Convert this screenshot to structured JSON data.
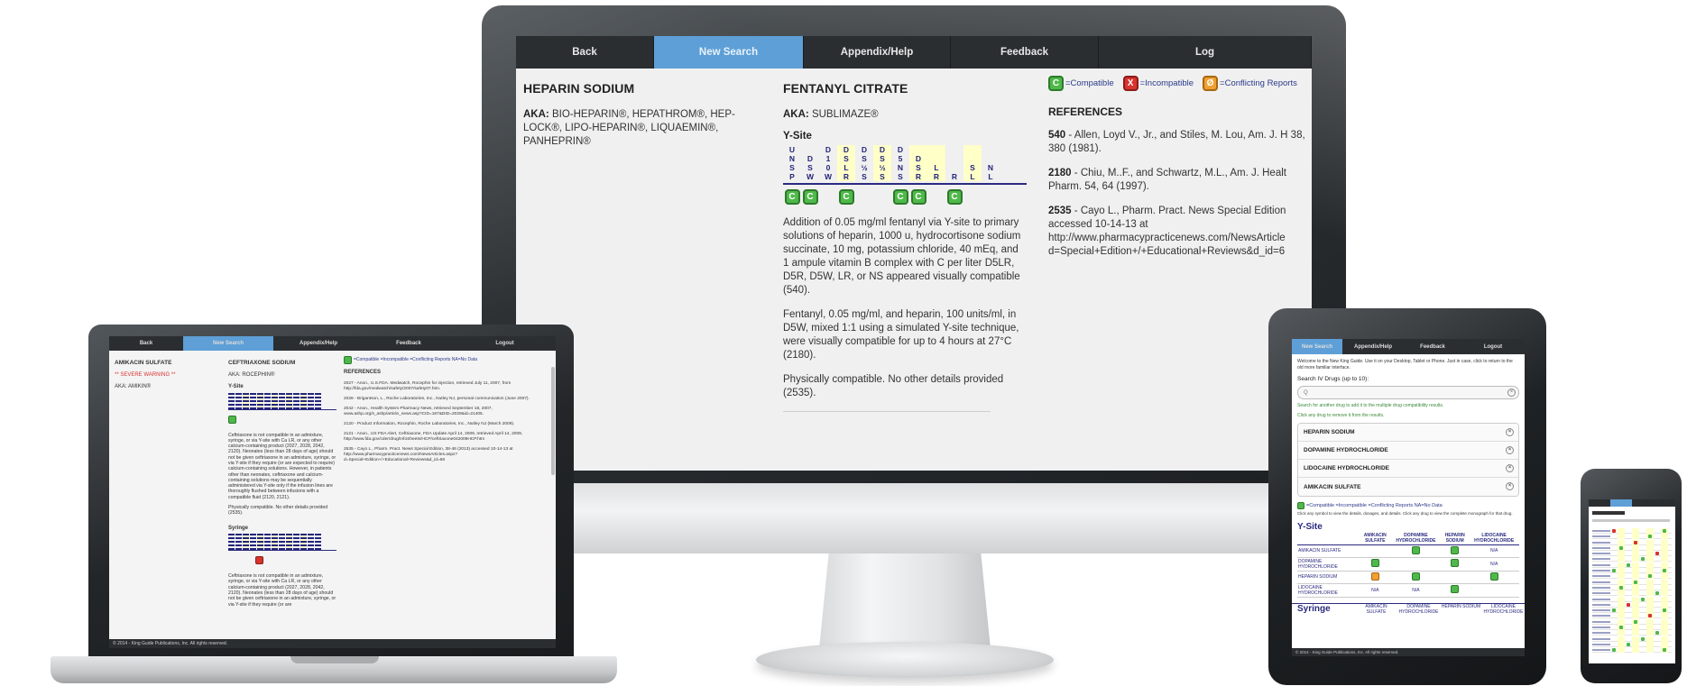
{
  "monitor": {
    "nav": [
      {
        "label": "Back",
        "active": false
      },
      {
        "label": "New Search",
        "active": true
      },
      {
        "label": "Appendix/Help",
        "active": false
      },
      {
        "label": "Feedback",
        "active": false
      },
      {
        "label": "Log",
        "active": false
      }
    ],
    "drug1": {
      "title": "HEPARIN SODIUM",
      "aka_label": "AKA:",
      "aka": "BIO-HEPARIN®, HEPATHROM®, HEP-LOCK®, LIPO-HEPARIN®, LIQUAEMIN®, PANHEPRIN®"
    },
    "drug2": {
      "title": "FENTANYL CITRATE",
      "aka_label": "AKA:",
      "aka": "SUBLIMAZE®",
      "ysite_title": "Y-Site",
      "ysite_columns": [
        {
          "letters": [
            "U",
            "N",
            "S",
            "P"
          ],
          "hl": false
        },
        {
          "letters": [
            "",
            "D",
            "S",
            "W"
          ],
          "hl": false
        },
        {
          "letters": [
            "D",
            "1",
            "0",
            "W"
          ],
          "hl": false
        },
        {
          "letters": [
            "D",
            "S",
            "L",
            "R"
          ],
          "hl": true
        },
        {
          "letters": [
            "D",
            "S",
            "½",
            "S"
          ],
          "hl": false
        },
        {
          "letters": [
            "D",
            "S",
            "½",
            "S"
          ],
          "hl": true
        },
        {
          "letters": [
            "D",
            "5",
            "N",
            "S"
          ],
          "hl": false
        },
        {
          "letters": [
            "",
            "D",
            "S",
            "R"
          ],
          "hl": true
        },
        {
          "letters": [
            "",
            "",
            "L",
            "R"
          ],
          "hl": true
        },
        {
          "letters": [
            "",
            "",
            "",
            "R"
          ],
          "hl": false
        },
        {
          "letters": [
            "",
            "",
            "S",
            "L"
          ],
          "hl": true
        },
        {
          "letters": [
            "",
            "",
            "N",
            "L"
          ],
          "hl": false
        }
      ],
      "badges": [
        "C",
        "C",
        "",
        "C",
        "",
        "",
        "C",
        "C",
        "",
        "C",
        "",
        ""
      ],
      "paragraphs": [
        "Addition of 0.05 mg/ml fentanyl via Y-site to primary solutions of heparin, 1000 u, hydrocortisone sodium succinate, 10 mg, potassium chloride, 40 mEq, and 1 ampule vitamin B complex with C per liter D5LR, D5R, D5W, LR, or NS appeared visually compatible (540).",
        "Fentanyl, 0.05 mg/ml, and heparin, 100 units/ml, in D5W, mixed 1:1 using a simulated Y-site technique, were visually compatible for up to 4 hours at 27°C (2180).",
        "Physically compatible. No other details provided (2535)."
      ]
    },
    "legend": {
      "compatible_symbol": "C",
      "compatible": "=Compatible",
      "incompatible_symbol": "X",
      "incompatible": "=Incompatible",
      "conflicting_symbol": "Ø",
      "conflicting": "=Conflicting Reports"
    },
    "references_title": "REFERENCES",
    "references": [
      {
        "id": "540",
        "text": " - Allen, Loyd V., Jr., and Stiles, M. Lou, Am. J. H 38, 380 (1981)."
      },
      {
        "id": "2180",
        "text": " - Chiu, M..F., and Schwartz, M.L., Am. J. Healt Pharm. 54, 64 (1997)."
      },
      {
        "id": "2535",
        "text": " - Cayo L., Pharm. Pract. News Special Edition accessed 10-14-13 at http://www.pharmacypracticenews.com/NewsArticle d=Special+Edition+/+Educational+Reviews&d_id=6"
      }
    ]
  },
  "laptop": {
    "nav": [
      "Back",
      "New Search",
      "Appendix/Help",
      "Feedback",
      "Logout"
    ],
    "drug1_title": "AMIKACIN SULFATE",
    "drug1_warning": "** SEVERE WARNING **",
    "drug1_aka": "AKA: AMIKIN®",
    "drug2_title": "CEFTRIAXONE SODIUM",
    "drug2_aka": "AKA: ROCEPHIN®",
    "ysite": "Y-Site",
    "syringe": "Syringe",
    "para1": "Ceftriaxone is not compatible in an admixture, syringe, or via Y-site with Ca LR, or any other calcium-containing product (2027, 2028, 2042, 2120). Neonates (less than 28 days of age) should not be given ceftriaxone in an admixture, syringe, or via Y-site if they require (or are expected to require) calcium-containing solutions. However, in patients other than neonates, ceftriaxone and calcium-containing solutions may be sequentially administered via Y-site only if the infusion lines are thoroughly flushed between infusions with a compatible fluid (2120, 2121).",
    "para2": "Physically compatible. No other details provided (2535).",
    "para3": "Ceftriaxone is not compatible in an admixture, syringe, or via Y-site with Ca LR, or any other calcium-containing product (2027, 2028, 2042, 2120). Neonates (less than 28 days of age) should not be given ceftriaxone in an admixture, syringe, or via Y-site if they require (or are",
    "legend": "=Compatible  =Incompatible  =Conflicting Reports  NA=No Data",
    "references_title": "REFERENCES",
    "references": [
      "2027 - Anon., U.S.FDA. Medwatch, Rocephin for injection, retrieved July 11, 2007, from http://fda.gov/medwatch/safety/2007/safety07.htm.",
      "2028 - Brigantson, L., Roche Laboratories, Inc., Nutley NJ, personal communication (June 2007).",
      "2042 - Anon., Health System Pharmacy News, retrieved September 18, 2007, www.ashp.org/s_ashp/article_news.asp?CID=167&DID=2029&id=21405.",
      "2120 - Product Information, Rocephin, Roche Laboratories, Inc., Nutley NJ (March 2009).",
      "2121 - Anon., US FDA Alert, Ceftriaxone, FDA Update April 14, 2009, retrieved April 14, 2009, http://www.fda.gov/cder/drug/InfoSheets/HCP/ceftriaxone042009HCP.htm",
      "2535 - Cayo L., Pharm. Pract. News Special Edition, 38-46 (2013) accessed 10-14-13 at http://www.pharmacypracticenews.com/NewsArticles.aspx?d=Special+Edition+/+Educational+Reviews&d_id=68"
    ],
    "footer": "© 2014 - King Guide Publications, Inc. All rights reserved."
  },
  "tablet": {
    "nav": [
      "New Search",
      "Appendix/Help",
      "Feedback",
      "Logout"
    ],
    "welcome": "Welcome to the New King Guide. Use it on your Desktop, Tablet or Phone. Just in case, click to return to the old more familiar interface.",
    "search_label": "Search IV Drugs (up to 10):",
    "search_placeholder": "Q",
    "hint1": "Search for another drug to add it to the multiple drug compatibility results.",
    "hint2": "Click any drug to remove it from the results.",
    "drugs": [
      "HEPARIN SODIUM",
      "DOPAMINE HYDROCHLORIDE",
      "LIDOCAINE HYDROCHLORIDE",
      "AMIKACIN SULFATE"
    ],
    "legend": "=Compatible  =Incompatible  =Conflicting Reports  NA=No Data",
    "legend_note": "Click any symbol to view the details, dosages, and details. Click any drug to view the complete monograph for that drug.",
    "ysite_title": "Y-Site",
    "syringe_title": "Syringe",
    "table_headers": [
      "AMIKACIN SULFATE",
      "DOPAMINE HYDROCHLORIDE",
      "HEPARIN SODIUM",
      "LIDOCAINE HYDROCHLORIDE"
    ],
    "table_rows": [
      {
        "drug": "AMIKACIN SULFATE",
        "cells": [
          "",
          "C",
          "C",
          "N/A"
        ]
      },
      {
        "drug": "DOPAMINE HYDROCHLORIDE",
        "cells": [
          "C",
          "",
          "C",
          "N/A"
        ]
      },
      {
        "drug": "HEPARIN SODIUM",
        "cells": [
          "Ø",
          "C",
          "",
          "C"
        ]
      },
      {
        "drug": "LIDOCAINE HYDROCHLORIDE",
        "cells": [
          "N/A",
          "N/A",
          "C",
          ""
        ]
      }
    ],
    "footer": "© 2014 - King Guide Publications, Inc. All rights reserved."
  },
  "colors": {
    "nav_bg": "#2b2e31",
    "nav_active": "#5d9fd6",
    "compatible": "#4fb84a",
    "incompatible": "#d8332e",
    "conflicting": "#f0a030",
    "highlight": "#ffffc8"
  }
}
